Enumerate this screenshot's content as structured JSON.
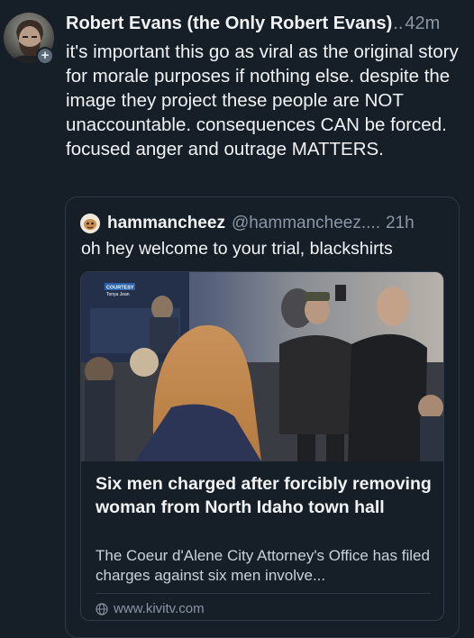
{
  "post": {
    "author_name": "Robert Evans (the Only Robert Evans)",
    "separator": "..",
    "time": "42m",
    "follow_symbol": "+",
    "text": "it's important this go as viral as the original story for morale purposes if nothing else. despite the image they project these people are NOT unaccountable. consequences CAN be forced. focused anger and outrage MATTERS."
  },
  "quote": {
    "author_name": "hammancheez",
    "handle": "@hammancheez....",
    "time": "21h",
    "text": "oh hey welcome to your trial, blackshirts",
    "link_card": {
      "image_caption_line1": "COURTESY",
      "image_caption_line2": "Tonya Jean",
      "title": "Six men charged after forcibly removing woman from North Idaho town hall",
      "description": "The Coeur d'Alene City Attorney's Office has filed charges against six men involve...",
      "domain": "www.kivitv.com"
    }
  },
  "colors": {
    "background": "#161e27",
    "text_primary": "#f1f3f5",
    "text_secondary": "#8a97a6",
    "border": "#2e3a47"
  }
}
